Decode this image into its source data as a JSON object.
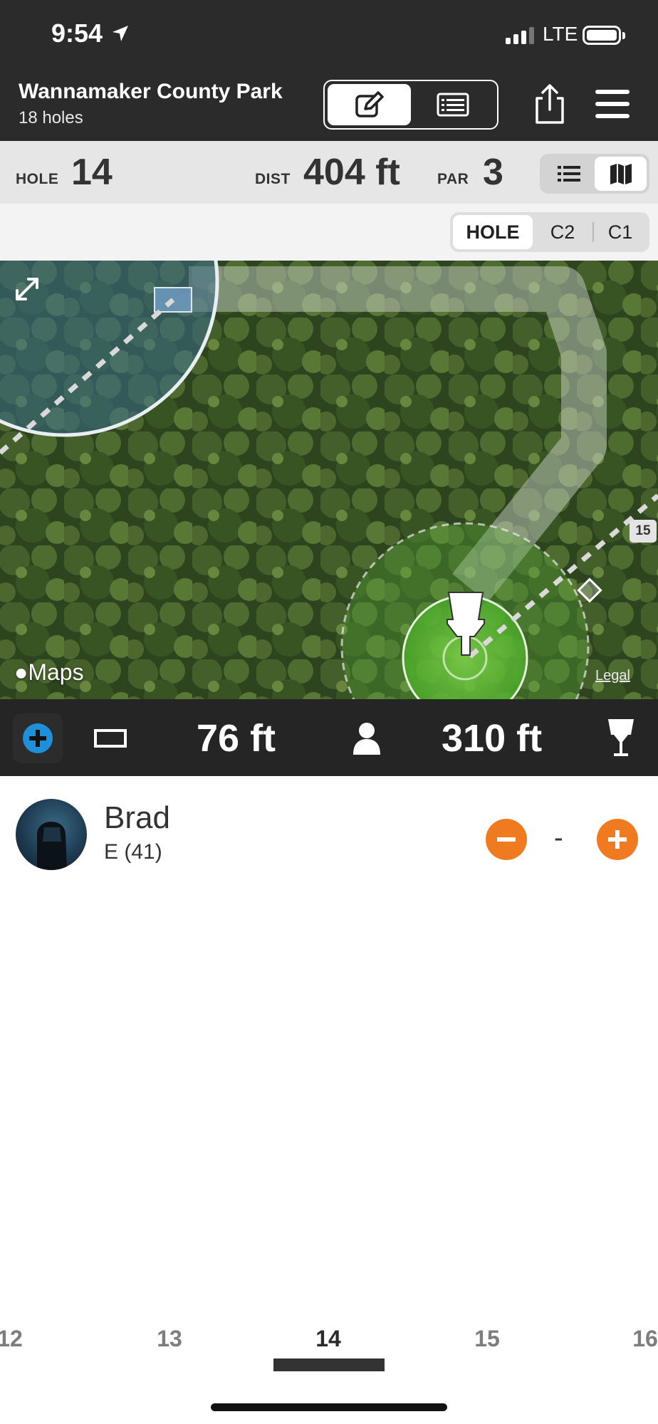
{
  "status": {
    "time": "9:54",
    "network": "LTE"
  },
  "header": {
    "course_name": "Wannamaker County Park",
    "hole_count": "18 holes",
    "mode_buttons": [
      {
        "icon": "edit-icon",
        "active": true
      },
      {
        "icon": "scorecard-icon",
        "active": false
      }
    ],
    "share_icon": "share-icon",
    "menu_icon": "hamburger-menu-icon"
  },
  "hole_info": {
    "hole_label": "HOLE",
    "hole_number": "14",
    "dist_label": "DIST",
    "distance": "404 ft",
    "par_label": "PAR",
    "par": "3",
    "view_toggle": [
      {
        "icon": "list-icon",
        "active": false
      },
      {
        "icon": "map-icon",
        "active": true
      }
    ]
  },
  "target_selector": {
    "options": [
      "HOLE",
      "C2",
      "C1"
    ],
    "selected": "HOLE"
  },
  "map": {
    "attribution": "Maps",
    "legal": "Legal",
    "next_hole_badge": "15"
  },
  "distance_bar": {
    "from_tee": "76 ft",
    "to_basket": "310 ft"
  },
  "player": {
    "name": "Brad",
    "total": "E (41)",
    "strokes": "-"
  },
  "hole_nav": {
    "holes": [
      "12",
      "13",
      "14",
      "15",
      "16"
    ],
    "current": "14"
  },
  "colors": {
    "header_bg": "#2b2b2b",
    "accent_orange": "#f07a20",
    "accent_blue": "#1e8fd8"
  }
}
